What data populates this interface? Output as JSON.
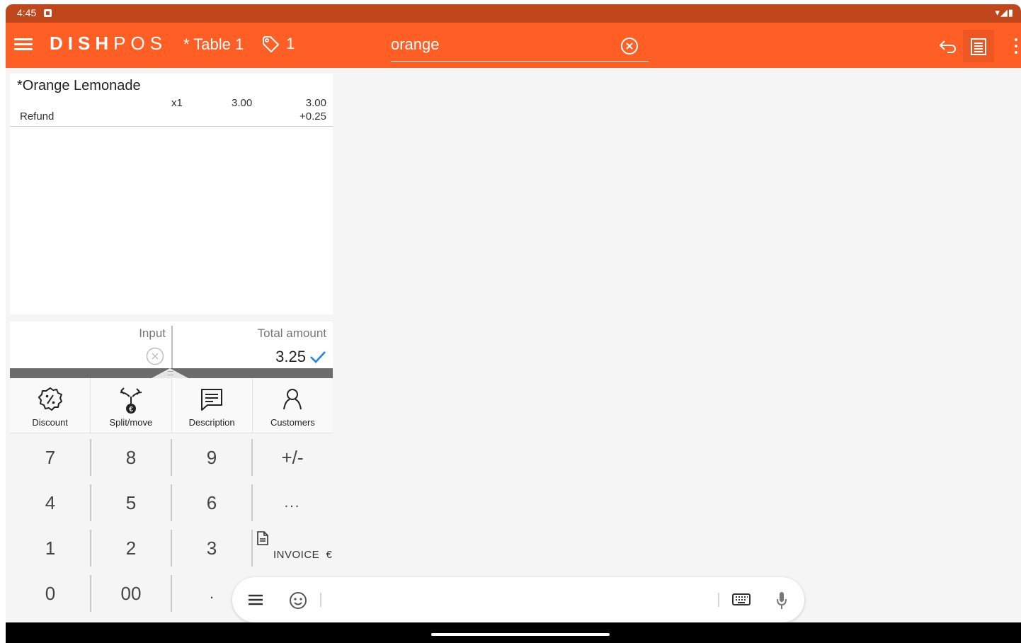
{
  "status_bar": {
    "time": "4:45",
    "system_icons": "▾◢▮"
  },
  "app_bar": {
    "logo_bold": "DISH",
    "logo_light": "POS",
    "table_title": "* Table 1",
    "tag_count": "1",
    "search_value": "orange",
    "background_color": "#ff5e24"
  },
  "order": {
    "items": [
      {
        "name": "*Orange Lemonade",
        "quantity": "x1",
        "unit_price": "3.00",
        "total": "3.00",
        "modifier": "Refund",
        "modifier_price": "+0.25"
      }
    ]
  },
  "amounts": {
    "input_label": "Input",
    "input_value": "",
    "total_label": "Total amount",
    "total_value": "3.25"
  },
  "actions": [
    {
      "label": "Discount",
      "icon": "discount-icon"
    },
    {
      "label": "Split/move",
      "icon": "split-move-icon"
    },
    {
      "label": "Description",
      "icon": "description-icon"
    },
    {
      "label": "Customers",
      "icon": "customer-icon"
    }
  ],
  "keypad": {
    "keys": [
      "7",
      "8",
      "9",
      "+/-",
      "4",
      "5",
      "6",
      "...",
      "1",
      "2",
      "3",
      "0",
      "00",
      "."
    ],
    "invoice_label": "INVOICE",
    "currency": "€"
  },
  "colors": {
    "accent": "#ff5e24",
    "status_bar": "#c0461c",
    "confirm": "#1e88e5"
  }
}
